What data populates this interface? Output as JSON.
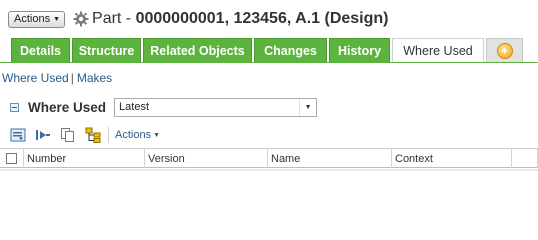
{
  "header": {
    "actions_label": "Actions",
    "object_type": "Part - ",
    "object_identity": "0000000001, 123456, A.1 (Design)"
  },
  "tabs": [
    {
      "label": "Details",
      "active": false
    },
    {
      "label": "Structure",
      "active": false
    },
    {
      "label": "Related Objects",
      "active": false
    },
    {
      "label": "Changes",
      "active": false
    },
    {
      "label": "History",
      "active": false
    },
    {
      "label": "Where Used",
      "active": true
    }
  ],
  "subnav": {
    "where_used": "Where Used",
    "makes": "Makes"
  },
  "section": {
    "title": "Where Used",
    "filter_value": "Latest"
  },
  "toolbar": {
    "actions_label": "Actions"
  },
  "table": {
    "columns": [
      "Number",
      "Version",
      "Name",
      "Context",
      ""
    ]
  },
  "colors": {
    "tab_green": "#5cb43e",
    "link_blue": "#2a5a86"
  },
  "icons": [
    "gear-icon",
    "add-tab-icon",
    "collapse-icon",
    "dropdown-arrow-icon",
    "expand-all-icon",
    "expand-one-icon",
    "copy-icon",
    "structure-icon"
  ]
}
